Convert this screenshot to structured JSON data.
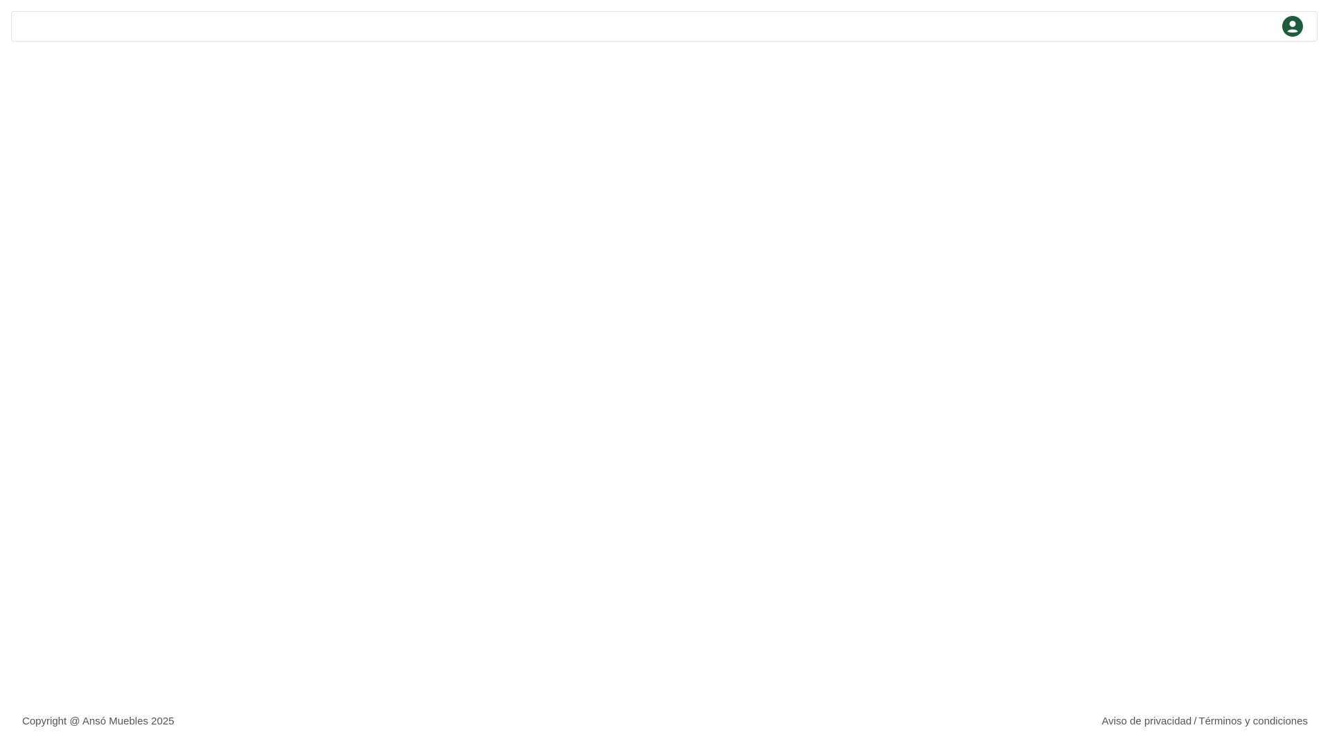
{
  "colors": {
    "accent": "#1d5c3d",
    "footer_text": "#555555",
    "border": "#e1e4e8"
  },
  "header": {
    "user_icon": "user-circle-icon"
  },
  "footer": {
    "copyright": "Copyright @ Ansó Muebles 2025",
    "privacy_link": "Aviso de privacidad",
    "separator": "/",
    "terms_link": "Términos y condiciones"
  }
}
